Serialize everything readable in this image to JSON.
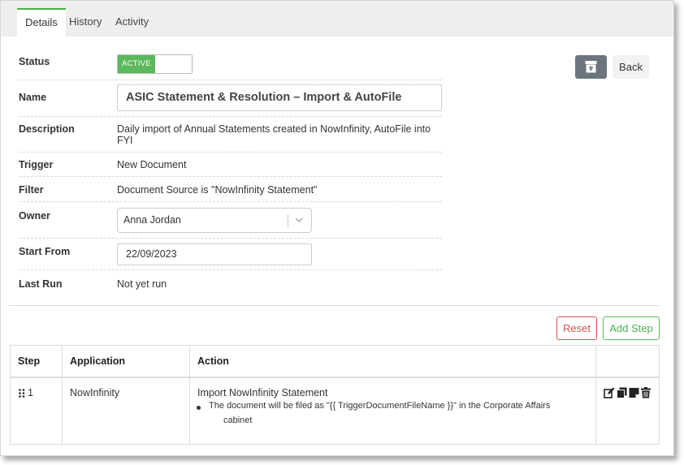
{
  "tabs": [
    {
      "label": "Details",
      "active": true
    },
    {
      "label": "History",
      "active": false
    },
    {
      "label": "Activity",
      "active": false
    }
  ],
  "fields": {
    "status_label": "Status",
    "status_value": "ACTIVE",
    "name_label": "Name",
    "name_value": "ASIC Statement & Resolution – Import & AutoFile",
    "description_label": "Description",
    "description_value": "Daily import of Annual Statements created in NowInfinity, AutoFile into FYI",
    "trigger_label": "Trigger",
    "trigger_value": "New Document",
    "filter_label": "Filter",
    "filter_value": "Document Source is \"NowInfinity Statement\"",
    "owner_label": "Owner",
    "owner_value": "Anna Jordan",
    "start_label": "Start From",
    "start_value": "22/09/2023",
    "lastrun_label": "Last Run",
    "lastrun_value": "Not yet run"
  },
  "buttons": {
    "back": "Back",
    "reset": "Reset",
    "add_step": "Add Step"
  },
  "table": {
    "headers": {
      "step": "Step",
      "application": "Application",
      "action": "Action"
    },
    "rows": [
      {
        "step": "1",
        "application": "NowInfinity",
        "action_title": "Import NowInfinity Statement",
        "action_detail_line1": "The document will be filed as \"{{ TriggerDocumentFileName }}\" in the Corporate Affairs",
        "action_detail_line2": "cabinet"
      }
    ]
  },
  "colors": {
    "accent_green": "#5cb85c",
    "danger_red": "#d9534f",
    "archive_gray": "#6c757d"
  },
  "icons": [
    "drag-handle-icon",
    "edit-icon",
    "copy-icon",
    "note-icon",
    "trash-icon",
    "archive-icon",
    "chevron-down-icon"
  ]
}
